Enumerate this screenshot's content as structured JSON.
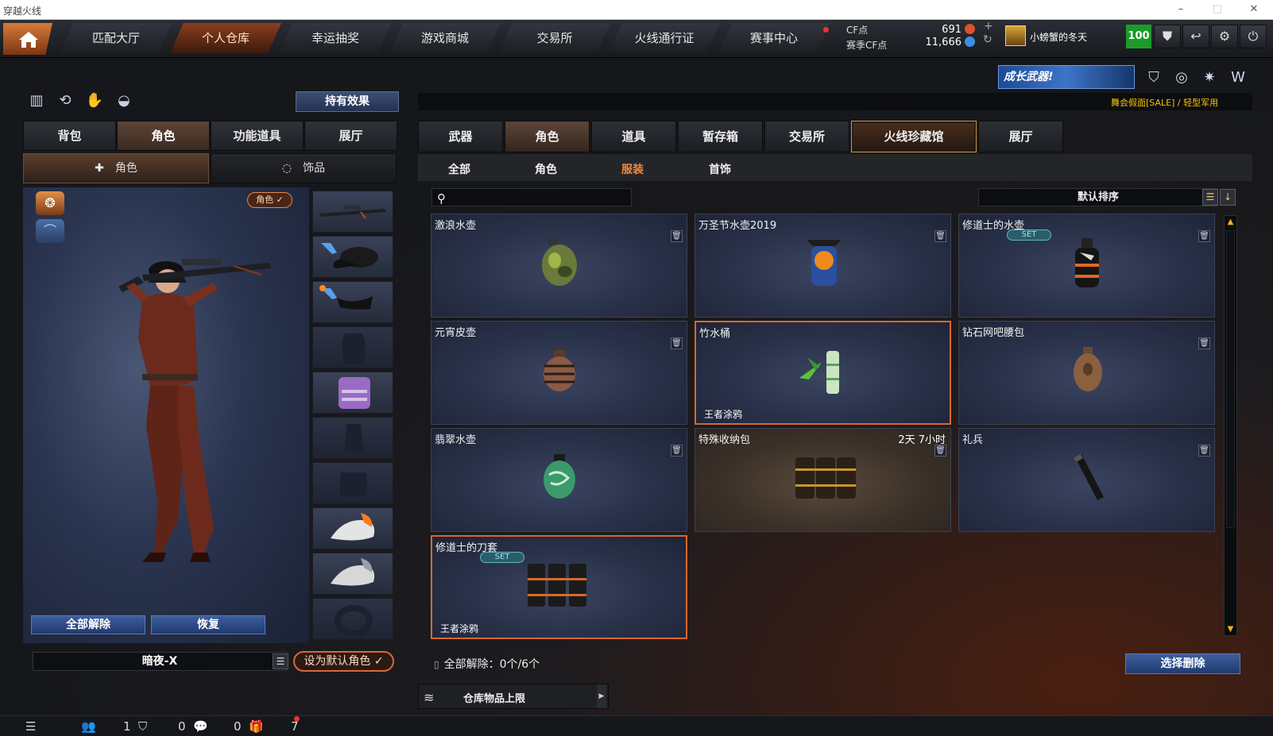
{
  "window": {
    "title": "穿越火线",
    "controls": [
      "–",
      "□",
      "✕"
    ]
  },
  "topnav": {
    "tabs": [
      {
        "label": "匹配大厅",
        "active": false
      },
      {
        "label": "个人仓库",
        "active": true
      },
      {
        "label": "幸运抽奖",
        "active": false
      },
      {
        "label": "游戏商城",
        "active": false
      },
      {
        "label": "交易所",
        "active": false
      },
      {
        "label": "火线通行证",
        "active": false
      },
      {
        "label": "赛事中心",
        "active": false
      }
    ],
    "cf_label": "CF点",
    "season_cf_label": "赛季CF点",
    "cf_value": "691",
    "season_cf_value": "11,666",
    "user_name": "小螃蟹的冬天",
    "level": "100"
  },
  "left": {
    "effect_button": "持有效果",
    "tabs": [
      {
        "label": "背包",
        "active": false
      },
      {
        "label": "角色",
        "active": true
      },
      {
        "label": "功能道具",
        "active": false
      },
      {
        "label": "展厅",
        "active": false
      }
    ],
    "subtabs": [
      {
        "label": "角色",
        "active": true
      },
      {
        "label": "饰品",
        "active": false
      }
    ],
    "role_tag": "角色 ✓",
    "unequip_all": "全部解除",
    "restore": "恢复",
    "character_name": "暗夜-X",
    "set_default": "设为默认角色 ✓"
  },
  "right": {
    "banner_text": "成长武器!",
    "ticker": "舞会假面[SALE] / 轻型军用",
    "tabs": [
      {
        "label": "武器",
        "active": false
      },
      {
        "label": "角色",
        "active": true
      },
      {
        "label": "道具",
        "active": false
      },
      {
        "label": "暂存箱",
        "active": false
      },
      {
        "label": "交易所",
        "active": false
      },
      {
        "label": "火线珍藏馆",
        "active": false,
        "special": true
      },
      {
        "label": "展厅",
        "active": false
      }
    ],
    "subtabs": [
      {
        "label": "全部",
        "active": false
      },
      {
        "label": "角色",
        "active": false
      },
      {
        "label": "服装",
        "active": true
      },
      {
        "label": "首饰",
        "active": false
      }
    ],
    "search_placeholder": "",
    "sort_label": "默认排序",
    "items": [
      {
        "name": "激浪水壶",
        "icon": "camo-canteen"
      },
      {
        "name": "万圣节水壶2019",
        "icon": "halloween-canteen"
      },
      {
        "name": "修道士的水壶",
        "icon": "monk-canteen",
        "set": "SET"
      },
      {
        "name": "元宵皮壶",
        "icon": "leather-canteen"
      },
      {
        "name": "竹水桶",
        "icon": "bamboo-bucket",
        "graffiti": "王者涂鸦",
        "highlight": true
      },
      {
        "name": "钻石网吧腰包",
        "icon": "waist-pouch"
      },
      {
        "name": "翡翠水壶",
        "icon": "jade-canteen"
      },
      {
        "name": "特殊收纳包",
        "icon": "storage-pack",
        "timer": "2天 7小时",
        "brown": true
      },
      {
        "name": "礼兵",
        "icon": "ceremonial-baton"
      },
      {
        "name": "修道士的刀套",
        "icon": "knife-holster",
        "set": "SET",
        "graffiti": "王者涂鸦",
        "highlight": true
      }
    ],
    "unequip_status": "全部解除：0个/6个",
    "select_delete": "选择删除",
    "capacity_label": "仓库物品上限"
  },
  "statusbar": {
    "friends": "1",
    "clan": "0",
    "messages": "0",
    "gifts": "7"
  },
  "colors": {
    "accent_orange": "#d8682c",
    "level_green": "#1c9b2b",
    "ticker_yellow": "#f5c400",
    "button_blue": "#2e4c86"
  }
}
